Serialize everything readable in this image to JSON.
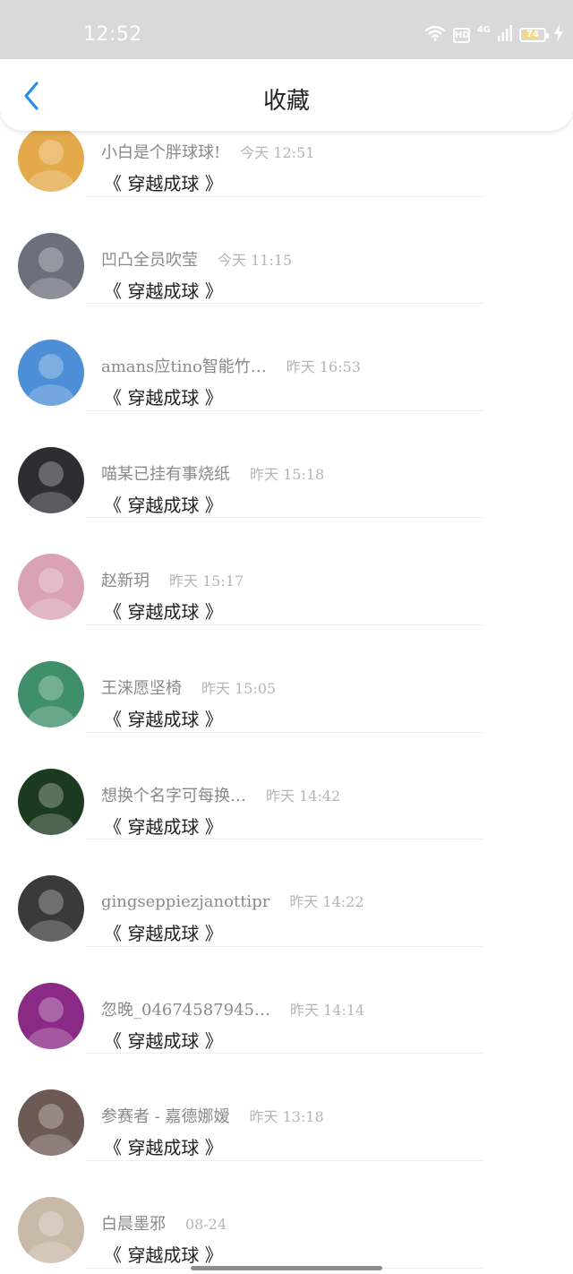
{
  "status_bar": {
    "time": "12:52",
    "hd": "HD",
    "network": "4G",
    "battery": "74"
  },
  "header": {
    "title": "收藏",
    "back_icon": "chevron-left-icon"
  },
  "items": [
    {
      "username": "小白是个胖球球!",
      "time": "今天 12:51",
      "title": "《 穿越成球 》",
      "avatar_color": "#e3a94a"
    },
    {
      "username": "凹凸全员吹莹",
      "time": "今天 11:15",
      "title": "《 穿越成球 》",
      "avatar_color": "#6d6f7d"
    },
    {
      "username": "amans应tino智能竹…",
      "time": "昨天 16:53",
      "title": "《 穿越成球 》",
      "avatar_color": "#4d8fd6"
    },
    {
      "username": "喵某已挂有事烧纸",
      "time": "昨天 15:18",
      "title": "《 穿越成球 》",
      "avatar_color": "#2d2d33"
    },
    {
      "username": "赵新玥",
      "time": "昨天 15:17",
      "title": "《 穿越成球 》",
      "avatar_color": "#d9a3b5"
    },
    {
      "username": "王涞愿坚椅",
      "time": "昨天 15:05",
      "title": "《 穿越成球 》",
      "avatar_color": "#3f8f6a"
    },
    {
      "username": "想换个名字可每换…",
      "time": "昨天 14:42",
      "title": "《 穿越成球 》",
      "avatar_color": "#1c3a1f"
    },
    {
      "username": "gingseppiezjanottipr",
      "time": "昨天 14:22",
      "title": "《 穿越成球 》",
      "avatar_color": "#3a3a3a"
    },
    {
      "username": "忽晚_04674587945…",
      "time": "昨天 14:14",
      "title": "《 穿越成球 》",
      "avatar_color": "#8a2a86"
    },
    {
      "username": "参赛者 - 嘉德娜嫒",
      "time": "昨天 13:18",
      "title": "《 穿越成球 》",
      "avatar_color": "#6e5a55"
    },
    {
      "username": "白晨墨邪",
      "time": "08-24",
      "title": "《 穿越成球 》",
      "avatar_color": "#c9b9a8"
    }
  ]
}
